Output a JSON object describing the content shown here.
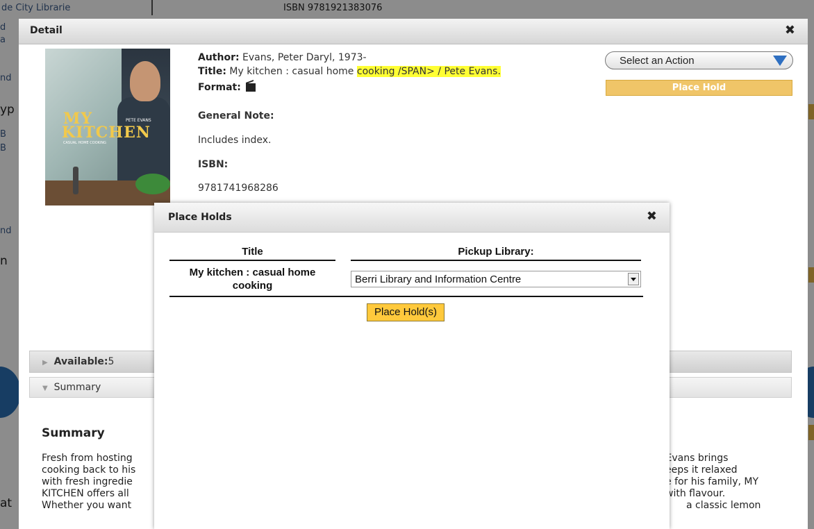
{
  "background": {
    "library_text": "de City Librarie",
    "isbn_text": "ISBN  9781921383076",
    "fragments": [
      "d",
      "a",
      "nd",
      "yp",
      "B",
      "B",
      "nd",
      "n",
      "at"
    ]
  },
  "detail": {
    "title": "Detail",
    "close_glyph": "✖",
    "cover": {
      "line1": "MY",
      "line2": "KITCHEN",
      "line3": "CASUAL HOME COOKING",
      "line4": "PETE EVANS"
    },
    "author_label": "Author:",
    "author_value": "Evans, Peter Daryl, 1973-",
    "title_label": "Title:",
    "title_value_plain": "My kitchen : casual home ",
    "title_value_highlight": "cooking /SPAN> / Pete Evans.",
    "format_label": "Format:",
    "general_note_label": "General Note:",
    "general_note_value": "Includes index.",
    "isbn_label": "ISBN:",
    "isbn_value": "9781741968286",
    "action_select": "Select an Action",
    "place_hold_button": "Place Hold",
    "available_label": "Available:",
    "available_count": "5",
    "summary_bar_label": "Summary",
    "summary_heading": "Summary",
    "summary_lines": [
      "Fresh from hosting",
      "cooking back to his",
      "with fresh ingredie",
      "KITCHEN offers all",
      "Whether you want"
    ],
    "summary_right_lines": [
      "te Evans brings",
      "eeps it relaxed",
      "e for his family, MY",
      "with flavour.",
      "a classic lemon"
    ]
  },
  "place_holds": {
    "title": "Place Holds",
    "close_glyph": "✖",
    "col_title": "Title",
    "col_library": "Pickup Library:",
    "item_title": "My kitchen : casual home cooking",
    "pickup_library": "Berri Library and Information Centre",
    "submit_label": "Place Hold(s)"
  },
  "colors": {
    "highlight": "#ffff33",
    "place_hold_gold": "#f0c568",
    "submit_gold": "#ffc93c",
    "select_arrow_blue": "#2e6fc1"
  }
}
